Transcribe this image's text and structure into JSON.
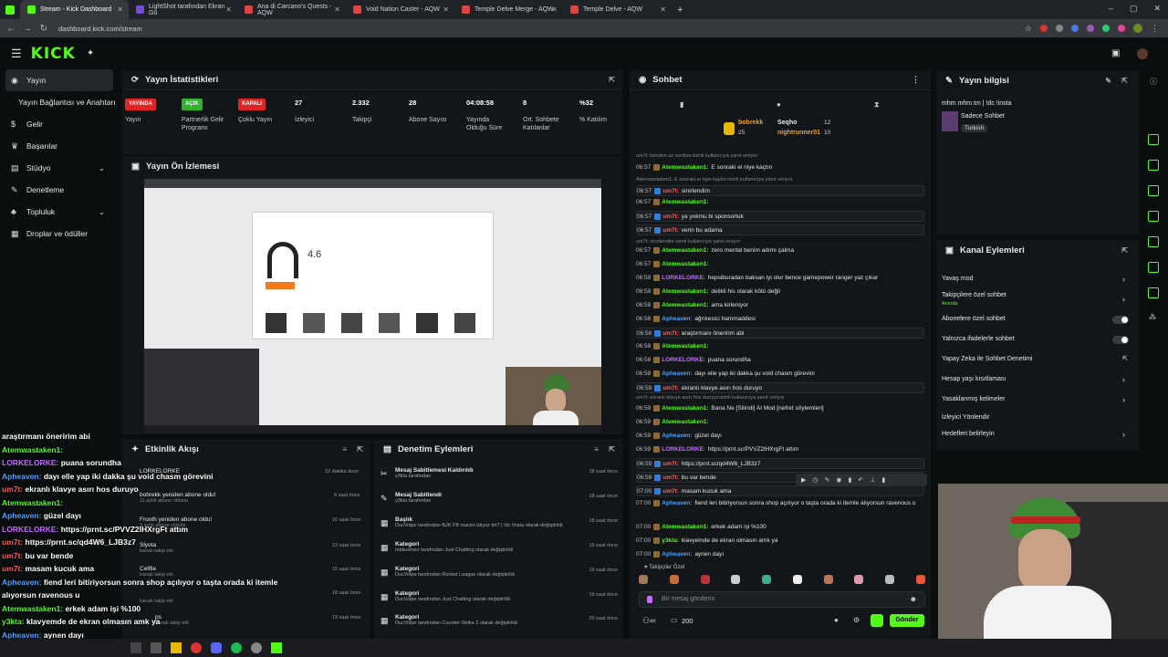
{
  "browser": {
    "tabs": [
      {
        "label": "Stream - Kick Dashboard",
        "color": "#53fc18"
      },
      {
        "label": "LightShot tarafından Ekran Gö",
        "color": "#7a4bd6"
      },
      {
        "label": "Ana di Carcano's Quests - AQW",
        "color": "#d44"
      },
      {
        "label": "Void Nation Caster - AQW",
        "color": "#d44"
      },
      {
        "label": "Temple Delve Merge - AQW",
        "color": "#d44"
      },
      {
        "label": "Temple Delve - AQW",
        "color": "#d44"
      }
    ],
    "url": "dashboard.kick.com/stream"
  },
  "header": {
    "logo": "KICK"
  },
  "sidebar": {
    "items": [
      {
        "label": "Yayın",
        "icon": "broadcast-icon"
      },
      {
        "label": "Yayın Bağlantısı ve Anahtarı",
        "icon": ""
      },
      {
        "label": "Gelir",
        "icon": "dollar-icon"
      },
      {
        "label": "Başarılar",
        "icon": "trophy-icon"
      },
      {
        "label": "Stüdyo",
        "icon": "studio-icon"
      },
      {
        "label": "Denetleme",
        "icon": "wrench-icon"
      },
      {
        "label": "Topluluk",
        "icon": "community-icon"
      },
      {
        "label": "Droplar ve ödüller",
        "icon": "gift-icon"
      }
    ]
  },
  "stats": {
    "title": "Yayın İstatistikleri",
    "items": [
      {
        "badge": "YAYINDA",
        "badge_color": "#e02424",
        "label": "Yayın"
      },
      {
        "badge": "AÇIK",
        "badge_color": "#2fb32a",
        "label": "Partnerlik Gelir Programı"
      },
      {
        "badge": "KAPALI",
        "badge_color": "#e02424",
        "label": "Çoklu Yayın"
      },
      {
        "value": "27",
        "label": "İzleyici"
      },
      {
        "value": "2.332",
        "label": "Takipçi"
      },
      {
        "value": "28",
        "label": "Abone Sayısı"
      },
      {
        "value": "04:08:58",
        "label": "Yayında Olduğu Süre"
      },
      {
        "value": "8",
        "label": "Ort. Sohbete Katılanlar"
      },
      {
        "value": "%32",
        "label": "% Katılım"
      }
    ]
  },
  "preview": {
    "title": "Yayın Ön İzlemesi",
    "product_rating": "4.6"
  },
  "activity": {
    "title": "Etkinlik Akışı",
    "items": [
      {
        "name": "LORKELORKE",
        "sub": "",
        "time": "22 dakika önce"
      },
      {
        "name": "bobrekk yeniden abone oldu!",
        "sub": "11 aylık abone oldular",
        "time": "6 saat önce"
      },
      {
        "name": "Frooth yeniden abone oldu!",
        "sub": "3 aylık abone oldular",
        "time": "10 saat önce"
      },
      {
        "name": "Slyota",
        "sub": "kanalı takip etti",
        "time": "13 saat önce"
      },
      {
        "name": "Cellfie",
        "sub": "kanalı takip etti",
        "time": "15 saat önce"
      },
      {
        "name": "",
        "sub": "kanalı takip etti",
        "time": "18 saat önce"
      },
      {
        "name": "ps",
        "sub": "kanalı takip etti",
        "time": "19 saat önce"
      }
    ]
  },
  "moderation": {
    "title": "Denetim Eylemleri",
    "items": [
      {
        "title": "Mesaj Sabitlemesi Kaldırıldı",
        "sub": "y3kta tarafından",
        "time": "18 saat önce"
      },
      {
        "title": "Mesaj Sabitlendi",
        "sub": "y3kta tarafından",
        "time": "18 saat önce"
      },
      {
        "title": "Başlık",
        "sub": "DucVolpe tarafından BJK FB macini izliyoz tm? | !dc !insta olarak değiştirildi",
        "time": "18 saat önce"
      },
      {
        "title": "Kategori",
        "sub": "mbkusmez tarafından Just Chatting olarak değiştirildi",
        "time": "19 saat önce"
      },
      {
        "title": "Kategori",
        "sub": "DucVolpe tarafından Rocket League olarak değiştirildi",
        "time": "19 saat önce"
      },
      {
        "title": "Kategori",
        "sub": "DucVolpe tarafından Just Chatting olarak değiştirildi",
        "time": "19 saat önce"
      },
      {
        "title": "Kategori",
        "sub": "DucVolpe tarafından Counter-Strike 2 olarak değiştirildi",
        "time": "20 saat önce"
      }
    ]
  },
  "chat": {
    "title": "Sohbet",
    "top": [
      {
        "name": "bobrekk",
        "count": "25"
      },
      {
        "name": "Seqho",
        "count": "12"
      },
      {
        "name": "nightrunner01",
        "count": "10"
      }
    ],
    "lines": [
      {
        "t": "",
        "u": "",
        "m": "um7t: benden az vurduin isimli kullanıcıya yanıt veriyor",
        "uc": "#888",
        "reply": true
      },
      {
        "t": "06:57",
        "u": "Atemwastaken1:",
        "m": " E sonraki ei niye kaçtın",
        "uc": "#53fc18"
      },
      {
        "t": "",
        "u": "",
        "m": "Atemwastaken1: E sonraki ei niye kaçtın isimli kullanıcıya yanıt veriyor",
        "uc": "#888",
        "reply": true
      },
      {
        "t": "06:57",
        "u": "um7t:",
        "m": " sinirlendim",
        "uc": "#ff5a5a"
      },
      {
        "t": "06:57",
        "u": "Atemwastaken1:",
        "m": "",
        "uc": "#53fc18"
      },
      {
        "t": "06:57",
        "u": "um7t:",
        "m": " ya yokmu bi sponsorluk",
        "uc": "#ff5a5a"
      },
      {
        "t": "06:57",
        "u": "um7t:",
        "m": " verin bu adama",
        "uc": "#ff5a5a"
      },
      {
        "t": "",
        "u": "",
        "m": "um7t: sinirlendim isimli kullanıcıya yanıt veriyor",
        "uc": "#888",
        "reply": true
      },
      {
        "t": "06:57",
        "u": "Atemwastaken1:",
        "m": " zero mental benim adımı çalma",
        "uc": "#53fc18"
      },
      {
        "t": "06:57",
        "u": "Atemwastaken1:",
        "m": "",
        "uc": "#53fc18"
      },
      {
        "t": "06:58",
        "u": "LORKELORKE:",
        "m": " hepsiburadan baksan iyi olur bence gamepower ranger yaz çıkar",
        "uc": "#c46bff"
      },
      {
        "t": "06:58",
        "u": "Atemwastaken1:",
        "m": " delikli his olarak kötü değil",
        "uc": "#53fc18"
      },
      {
        "t": "06:58",
        "u": "Atemwastaken1:",
        "m": " ama kirleniyor",
        "uc": "#53fc18"
      },
      {
        "t": "06:58",
        "u": "Apheaven:",
        "m": " ağrıkesici hammaddesi",
        "uc": "#4aa3ff"
      },
      {
        "t": "06:58",
        "u": "um7t:",
        "m": " araştırmanı öneririm abi",
        "uc": "#ff5a5a"
      },
      {
        "t": "06:58",
        "u": "Atemwastaken1:",
        "m": "",
        "uc": "#53fc18"
      },
      {
        "t": "06:58",
        "u": "LORKELORKE:",
        "m": " puana sorundha",
        "uc": "#c46bff"
      },
      {
        "t": "06:58",
        "u": "Apheaven:",
        "m": " dayı elle yap iki dakka şu void chasm görevini",
        "uc": "#4aa3ff"
      },
      {
        "t": "06:59",
        "u": "um7t:",
        "m": " ekranlı klavye asırı hos duruyo",
        "uc": "#ff5a5a"
      },
      {
        "t": "",
        "u": "",
        "m": "um7t: ekranlı klavye asırı hos duruyo isimli kullanıcıya yanıt veriyor",
        "uc": "#888",
        "reply": true
      },
      {
        "t": "06:59",
        "u": "Atemwastaken1:",
        "m": " Bana Ne [Silindi] AI Mod [nefret söylemleri]",
        "uc": "#53fc18"
      },
      {
        "t": "06:59",
        "u": "Atemwastaken1:",
        "m": "",
        "uc": "#53fc18"
      },
      {
        "t": "06:59",
        "u": "Apheaven:",
        "m": " güzel dayı",
        "uc": "#4aa3ff"
      },
      {
        "t": "06:59",
        "u": "LORKELORKE:",
        "m": " https://prnt.sc/PVVZ2lHXrgFt attım",
        "uc": "#c46bff"
      },
      {
        "t": "06:59",
        "u": "um7t:",
        "m": " https://prnt.sc/qd4W6_LJB3z7",
        "uc": "#ff5a5a"
      },
      {
        "t": "06:59",
        "u": "um7t:",
        "m": " bu var bende",
        "uc": "#ff5a5a"
      },
      {
        "t": "07:00",
        "u": "um7t:",
        "m": " masam kucuk ama",
        "uc": "#ff5a5a"
      },
      {
        "t": "07:00",
        "u": "Apheaven:",
        "m": " fiend leri bitiriyorsun sonra shop açılıyor o taşta orada ki itemle alıyorsun ravenous u",
        "uc": "#4aa3ff"
      },
      {
        "t": "07:00",
        "u": "Atemwastaken1:",
        "m": " erkek adam işi %100",
        "uc": "#53fc18"
      },
      {
        "t": "07:00",
        "u": "y3kta:",
        "m": " klavyemde de ekran olmasın amk ya",
        "uc": "#53fc18"
      },
      {
        "t": "07:00",
        "u": "Apheaven:",
        "m": " aynen dayı",
        "uc": "#4aa3ff"
      }
    ],
    "followers_label": "Takipçiler Özel",
    "input_placeholder": "Bir mesaj gönderin",
    "points": "200",
    "send_label": "Gönder"
  },
  "overlay_chat": [
    {
      "u": "",
      "m": "araştırmanı öneririm abi",
      "uc": "#fff"
    },
    {
      "u": "Atemwastaken1:",
      "m": "",
      "uc": "#53fc18"
    },
    {
      "u": "LORKELORKE:",
      "m": " puana sorundha",
      "uc": "#c46bff"
    },
    {
      "u": "Apheaven:",
      "m": " dayı elle yap iki dakka şu void chasm görevini",
      "uc": "#4aa3ff"
    },
    {
      "u": "um7t:",
      "m": " ekranlı klavye asırı hos duruyo",
      "uc": "#ff5a5a"
    },
    {
      "u": "Atemwastaken1:",
      "m": "",
      "uc": "#53fc18"
    },
    {
      "u": "Apheaven:",
      "m": " güzel dayı",
      "uc": "#4aa3ff"
    },
    {
      "u": "LORKELORKE:",
      "m": " https://prnt.sc/PVVZ2lHXrgFt attım",
      "uc": "#c46bff"
    },
    {
      "u": "um7t:",
      "m": " https://prnt.sc/qd4W6_LJB3z7",
      "uc": "#ff5a5a"
    },
    {
      "u": "um7t:",
      "m": " bu var bende",
      "uc": "#ff5a5a"
    },
    {
      "u": "um7t:",
      "m": " masam kucuk ama",
      "uc": "#ff5a5a"
    },
    {
      "u": "Apheaven:",
      "m": " fiend leri bitiriyorsun sonra shop açılıyor o taşta orada ki itemle",
      "uc": "#4aa3ff"
    },
    {
      "u": "",
      "m": "alıyorsun ravenous u",
      "uc": "#fff"
    },
    {
      "u": "Atemwastaken1:",
      "m": " erkek adam işi %100",
      "uc": "#53fc18"
    },
    {
      "u": "y3kta:",
      "m": " klavyemde de ekran olmasın amk ya",
      "uc": "#53fc18"
    },
    {
      "u": "Apheaven:",
      "m": " aynen dayı",
      "uc": "#4aa3ff"
    }
  ],
  "stream_info": {
    "title": "Yayın bilgisi",
    "stream_title": "mhm mhm tm | !dc !insta",
    "category": "Sadece Sohbet",
    "tag": "Turkish"
  },
  "channel_actions": {
    "title": "Kanal Eylemleri",
    "items": [
      {
        "label": "Yavaş mod",
        "sub": ""
      },
      {
        "label": "Takipçilere özel sohbet",
        "sub": "Anında"
      },
      {
        "label": "Abonelere özel sohbet",
        "sub": ""
      },
      {
        "label": "Yalnızca ifadelerle sohbet",
        "sub": ""
      },
      {
        "label": "Yapay Zeka ile Sohbet Denetimi",
        "sub": ""
      },
      {
        "label": "Hesap yaşı kısıtlaması",
        "sub": ""
      },
      {
        "label": "Yasaklanmış kelimeler",
        "sub": ""
      },
      {
        "label": "İzleyici Yönlendir",
        "sub": ""
      },
      {
        "label": "Hedefleri belirleyin",
        "sub": ""
      }
    ]
  },
  "colors": {
    "accent": "#53fc18",
    "live": "#e02424"
  }
}
